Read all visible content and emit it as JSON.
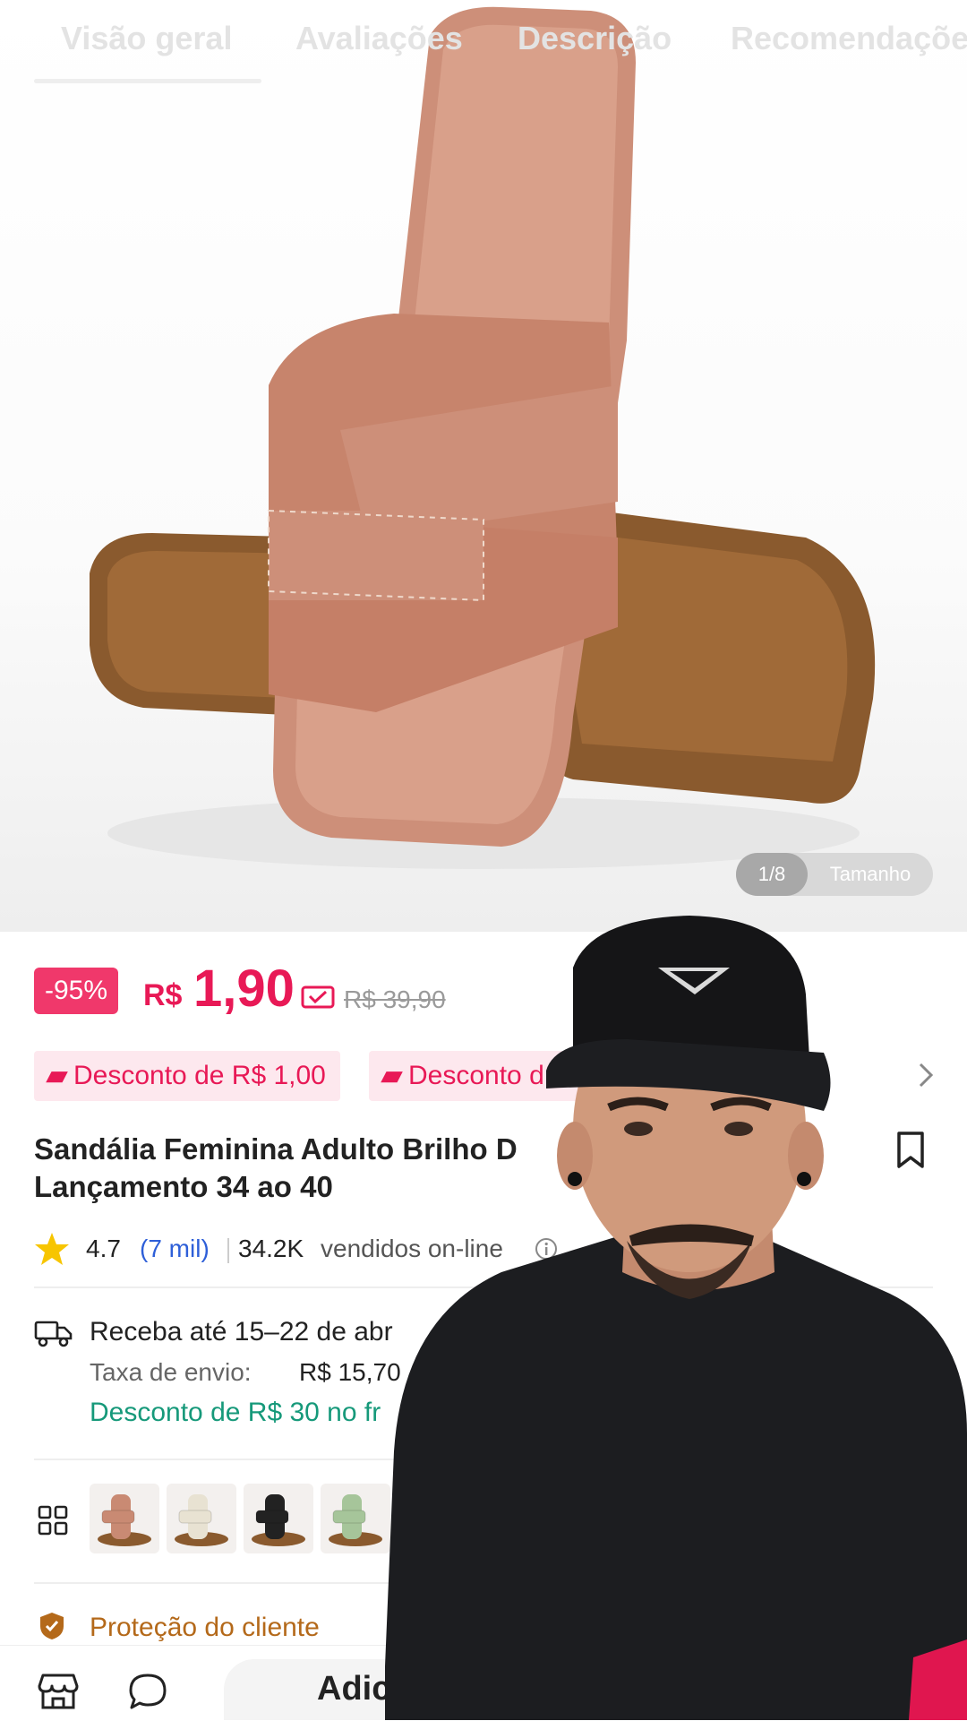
{
  "tabs": [
    {
      "label": "Visão geral"
    },
    {
      "label": "Avaliações"
    },
    {
      "label": "Descrição"
    },
    {
      "label": "Recomendações"
    }
  ],
  "gallery": {
    "counter": "1/8",
    "size_label": "Tamanho"
  },
  "price": {
    "discount_badge": "-95%",
    "currency": "R$",
    "value": "1,90",
    "original": "R$ 39,90",
    "accent_color": "#e81956"
  },
  "coupons": [
    {
      "label": "Desconto de R$ 1,00"
    },
    {
      "label": "Desconto d"
    }
  ],
  "product": {
    "title_line1": "Sandália Feminina Adulto Brilho D",
    "title_line2": "Lançamento 34 ao 40"
  },
  "rating": {
    "score": "4.7",
    "reviews": "(7 mil)",
    "sold_count": "34.2K",
    "sold_label": "vendidos on-line"
  },
  "shipping": {
    "delivery": "Receba até 15–22 de abr",
    "fee_label": "Taxa de envio:",
    "fee_value": "R$ 15,70",
    "promo": "Desconto de R$ 30 no fr"
  },
  "variants": [
    {
      "color": "#c98a73"
    },
    {
      "color": "#e8e2d2"
    },
    {
      "color": "#222222"
    },
    {
      "color": "#a6c59a"
    }
  ],
  "protection": {
    "label": "Proteção do cliente"
  },
  "bottom_bar": {
    "add_to_cart": "Adic"
  },
  "icons": [
    "store-icon",
    "chat-icon",
    "bookmark-icon",
    "star-icon",
    "info-icon",
    "truck-icon",
    "grid-icon",
    "shield-icon",
    "chevron-right-icon",
    "coupon-icon",
    "price-tag-icon"
  ]
}
